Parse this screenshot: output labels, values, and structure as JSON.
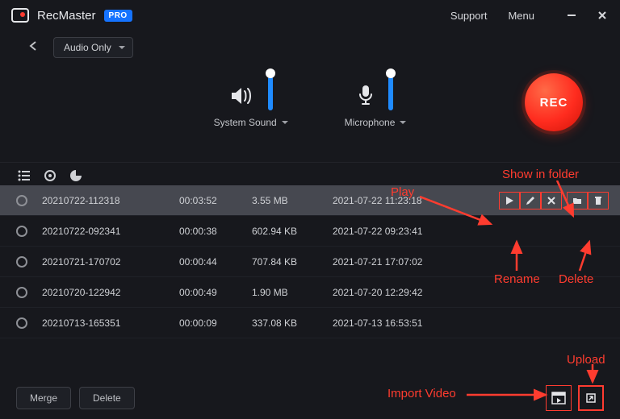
{
  "app": {
    "name": "RecMaster",
    "badge": "PRO"
  },
  "header": {
    "support": "Support",
    "menu": "Menu"
  },
  "mode": {
    "selected": "Audio Only"
  },
  "audio": {
    "system": {
      "label": "System Sound",
      "level": 0.92
    },
    "mic": {
      "label": "Microphone",
      "level": 0.92
    }
  },
  "rec": {
    "label": "REC"
  },
  "recordings": [
    {
      "name": "20210722-112318",
      "duration": "00:03:52",
      "size": "3.55 MB",
      "date": "2021-07-22 11:23:18",
      "selected": true
    },
    {
      "name": "20210722-092341",
      "duration": "00:00:38",
      "size": "602.94 KB",
      "date": "2021-07-22 09:23:41"
    },
    {
      "name": "20210721-170702",
      "duration": "00:00:44",
      "size": "707.84 KB",
      "date": "2021-07-21 17:07:02"
    },
    {
      "name": "20210720-122942",
      "duration": "00:00:49",
      "size": "1.90 MB",
      "date": "2021-07-20 12:29:42"
    },
    {
      "name": "20210713-165351",
      "duration": "00:00:09",
      "size": "337.08 KB",
      "date": "2021-07-13 16:53:51"
    }
  ],
  "footer": {
    "merge": "Merge",
    "delete": "Delete"
  },
  "annotations": {
    "play": "Play",
    "show_in_folder": "Show in folder",
    "rename": "Rename",
    "delete": "Delete",
    "import_video": "Import Video",
    "upload": "Upload"
  },
  "colors": {
    "accent": "#1573ff",
    "danger": "#ff3b30"
  }
}
